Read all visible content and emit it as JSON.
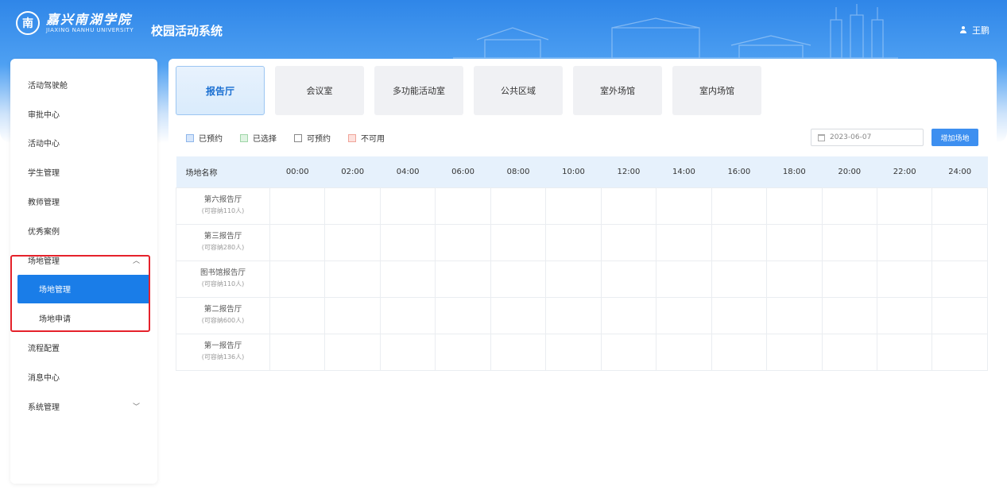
{
  "header": {
    "university_cn": "嘉兴南湖学院",
    "university_en": "JIAXING NANHU UNIVERSITY",
    "system_title": "校园活动系统",
    "user_name": "王鹏"
  },
  "sidebar": {
    "items": [
      {
        "label": "活动驾驶舱"
      },
      {
        "label": "审批中心"
      },
      {
        "label": "活动中心"
      },
      {
        "label": "学生管理"
      },
      {
        "label": "教师管理"
      },
      {
        "label": "优秀案例"
      },
      {
        "label": "场地管理",
        "expanded": true
      },
      {
        "label": "场地管理",
        "sub": true,
        "active": true
      },
      {
        "label": "场地申请",
        "sub": true
      },
      {
        "label": "流程配置"
      },
      {
        "label": "消息中心"
      },
      {
        "label": "系统管理",
        "expanded": false
      }
    ],
    "highlight_color": "#e5222b",
    "active_color": "#1a7de8"
  },
  "tabs": [
    {
      "label": "报告厅",
      "active": true
    },
    {
      "label": "会议室"
    },
    {
      "label": "多功能活动室"
    },
    {
      "label": "公共区域"
    },
    {
      "label": "室外场馆"
    },
    {
      "label": "室内场馆"
    }
  ],
  "legend": [
    {
      "label": "已预约",
      "fill": "#d6e6fb",
      "border": "#8fb6ea"
    },
    {
      "label": "已选择",
      "fill": "#dff3e2",
      "border": "#9fd6a8"
    },
    {
      "label": "可预约",
      "fill": "#ffffff",
      "border": "#888888"
    },
    {
      "label": "不可用",
      "fill": "#fde1dd",
      "border": "#f0a59a"
    }
  ],
  "date_value": "2023-06-07",
  "add_button": "增加场地",
  "table": {
    "name_header": "场地名称",
    "times": [
      "00:00",
      "02:00",
      "04:00",
      "06:00",
      "08:00",
      "10:00",
      "12:00",
      "14:00",
      "16:00",
      "18:00",
      "20:00",
      "22:00",
      "24:00"
    ],
    "rows": [
      {
        "name": "第六报告厅",
        "capacity": "(可容纳110人)"
      },
      {
        "name": "第三报告厅",
        "capacity": "(可容纳280人)"
      },
      {
        "name": "图书馆报告厅",
        "capacity": "(可容纳110人)"
      },
      {
        "name": "第二报告厅",
        "capacity": "(可容纳600人)"
      },
      {
        "name": "第一报告厅",
        "capacity": "(可容纳136人)"
      }
    ]
  }
}
